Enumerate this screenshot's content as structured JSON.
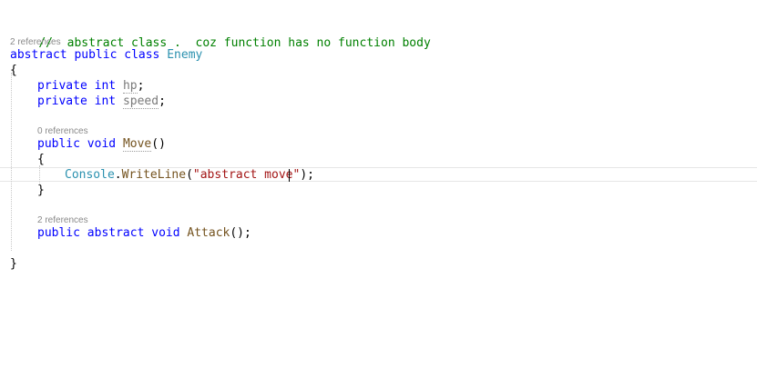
{
  "code": {
    "comment_line": "//  abstract class .  coz function has no function body",
    "class_refs": "2 references",
    "class_kw_abstract": "abstract",
    "class_kw_public": "public",
    "class_kw_class": "class",
    "class_name": "Enemy",
    "open_brace": "{",
    "field1": {
      "modifier": "private",
      "type": "int",
      "name": "hp",
      "semi": ";"
    },
    "field2": {
      "modifier": "private",
      "type": "int",
      "name": "speed",
      "semi": ";"
    },
    "move_refs": "0 references",
    "move_kw_public": "public",
    "move_kw_void": "void",
    "move_name": "Move",
    "move_parens": "()",
    "move_open": "{",
    "console_obj": "Console",
    "dot": ".",
    "console_method": "WriteLine",
    "paren_open": "(",
    "string_literal": "\"abstract move\"",
    "paren_close_semi": ");",
    "move_close": "}",
    "attack_refs": "2 references",
    "attack_kw_public": "public",
    "attack_kw_abstract": "abstract",
    "attack_kw_void": "void",
    "attack_name": "Attack",
    "attack_tail": "();",
    "close_brace": "}"
  }
}
